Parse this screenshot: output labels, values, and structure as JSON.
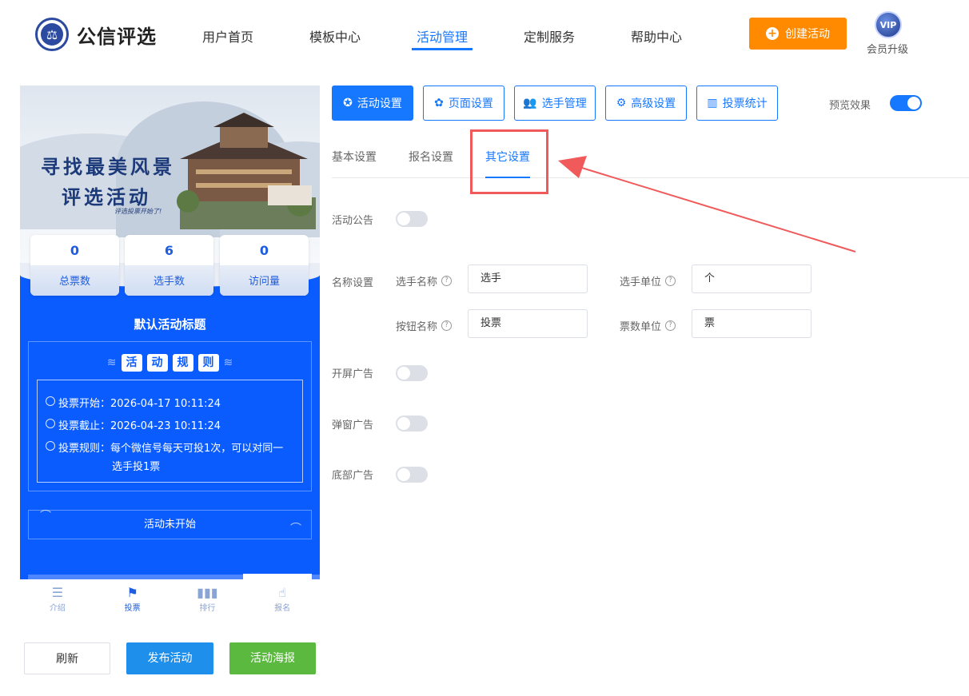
{
  "header": {
    "logo_text": "公信评选",
    "nav": [
      "用户首页",
      "模板中心",
      "活动管理",
      "定制服务",
      "帮助中心"
    ],
    "active_nav": "活动管理",
    "create_button": "创建活动",
    "vip_badge": "VIP",
    "vip_label": "会员升级",
    "accent": "#1677ff",
    "create_color": "#ff8a00"
  },
  "preview": {
    "banner_line1": "寻找最美风景",
    "banner_line2": "评选活动",
    "banner_small": "评选投票开始了!",
    "stats": [
      {
        "value": "0",
        "label": "总票数"
      },
      {
        "value": "6",
        "label": "选手数"
      },
      {
        "value": "0",
        "label": "访问量"
      }
    ],
    "activity_title": "默认活动标题",
    "rules_heading": [
      "活",
      "动",
      "规",
      "则"
    ],
    "vote_start": "投票开始：2026-04-17 10:11:24",
    "vote_end": "投票截止：2026-04-23 10:11:24",
    "vote_rule_line1": "投票规则：每个微信号每天可投1次，可以对同一",
    "vote_rule_line2": "选手投1票",
    "status": "活动未开始",
    "tabs": [
      {
        "icon": "document-icon",
        "label": "介绍"
      },
      {
        "icon": "flag-icon",
        "label": "投票"
      },
      {
        "icon": "bar-chart-icon",
        "label": "排行"
      },
      {
        "icon": "hand-icon",
        "label": "报名"
      }
    ],
    "bg_color": "#0a5cff"
  },
  "actions": {
    "refresh": "刷新",
    "publish": "发布活动",
    "poster": "活动海报"
  },
  "settings": {
    "top_tabs": [
      "活动设置",
      "页面设置",
      "选手管理",
      "高级设置",
      "投票统计"
    ],
    "preview_label": "预览效果",
    "preview_on": true,
    "sub_tabs": [
      "基本设置",
      "报名设置",
      "其它设置"
    ],
    "active_sub_tab": "其它设置",
    "announcement_label": "活动公告",
    "name_settings_label": "名称设置",
    "fields": {
      "contestant_name_label": "选手名称",
      "contestant_name_value": "选手",
      "contestant_unit_label": "选手单位",
      "contestant_unit_value": "个",
      "button_name_label": "按钮名称",
      "button_name_value": "投票",
      "vote_unit_label": "票数单位",
      "vote_unit_value": "票"
    },
    "splash_ad_label": "开屏广告",
    "popup_ad_label": "弹窗广告",
    "bottom_ad_label": "底部广告",
    "help_glyph": "?"
  }
}
